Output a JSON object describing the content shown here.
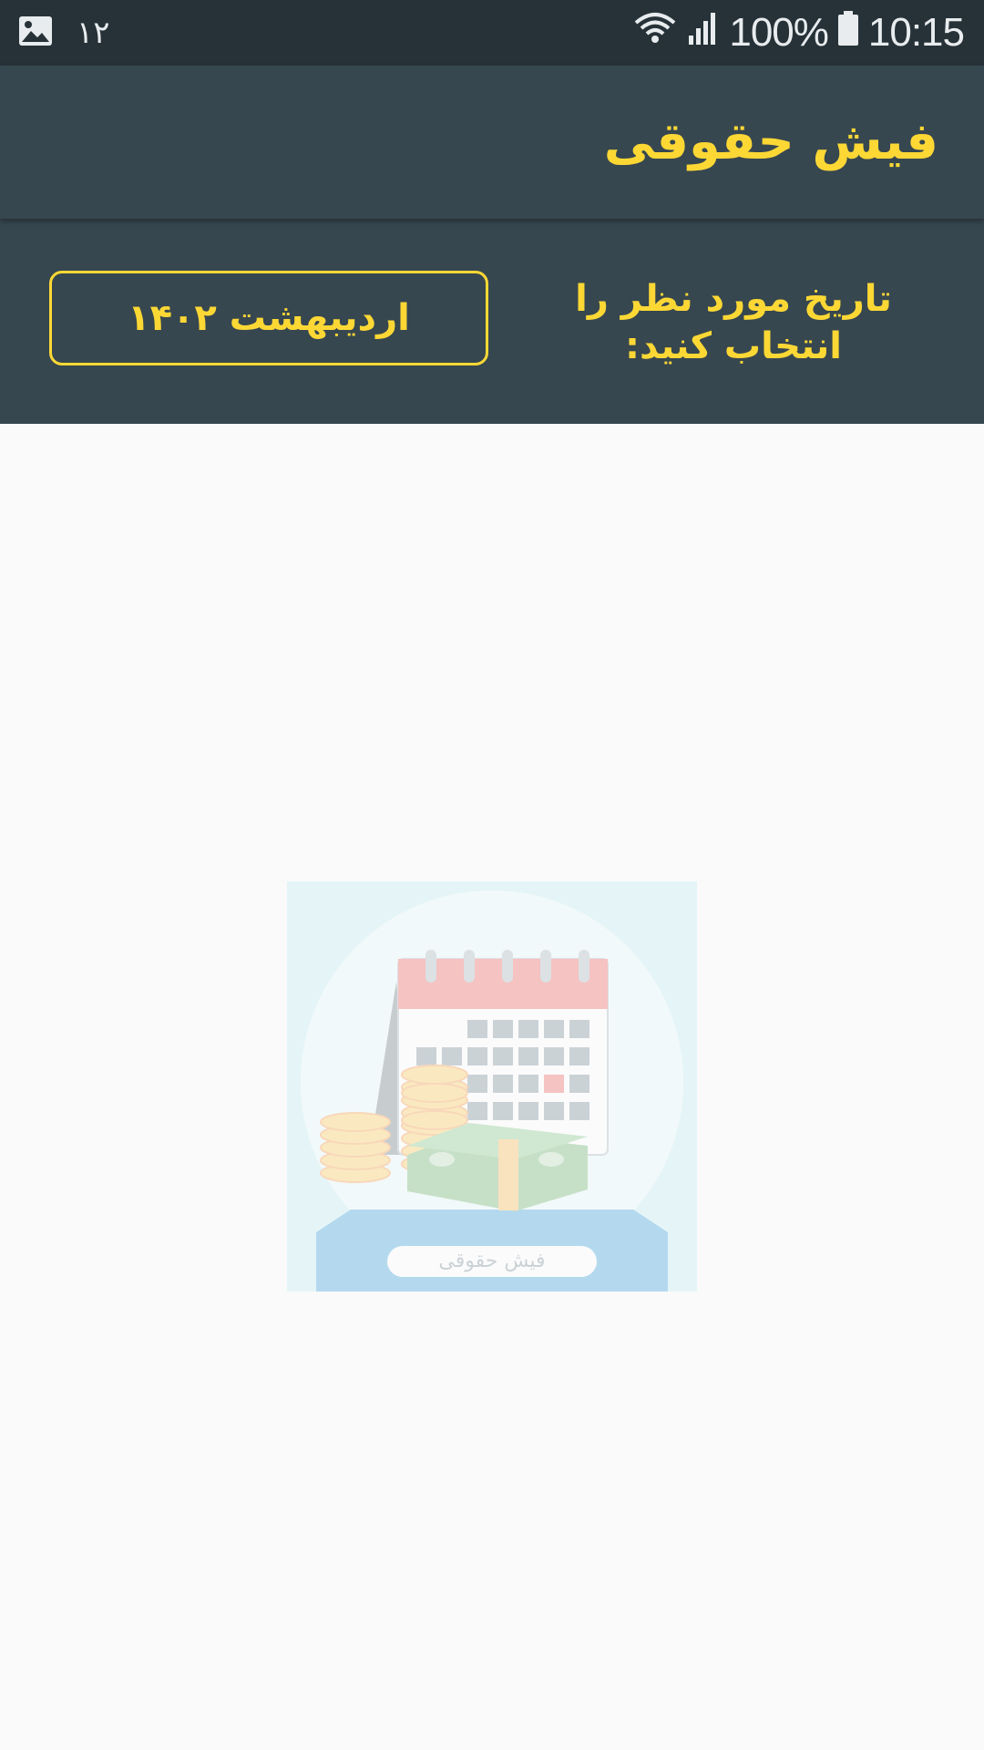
{
  "status_bar": {
    "notification_count": "۱۲",
    "battery": "100%",
    "time": "10:15",
    "icons": [
      "image-icon",
      "wifi-icon",
      "signal-icon",
      "battery-icon"
    ]
  },
  "app_bar": {
    "title": "فیش حقوقی"
  },
  "date_panel": {
    "prompt": "تاریخ مورد نظر را انتخاب کنید:",
    "selected_date": "اردیبهشت ۱۴۰۲"
  },
  "logo": {
    "label": "فیش حقوقی",
    "icon": "calendar-money-logo"
  },
  "colors": {
    "status_bar": "#263238",
    "app_bar": "#37474f",
    "accent": "#fdd835",
    "background": "#fafafa"
  }
}
